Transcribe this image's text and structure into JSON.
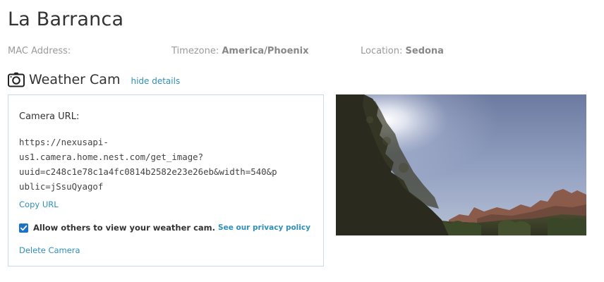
{
  "station": {
    "title": "La Barranca"
  },
  "meta": {
    "mac_label": "MAC Address:",
    "mac_value": "",
    "timezone_label": "Timezone:",
    "timezone_value": "America/Phoenix",
    "location_label": "Location:",
    "location_value": "Sedona"
  },
  "weather_cam": {
    "icon": "camera-icon",
    "title": "Weather Cam",
    "hide_details_label": "hide details",
    "camera_url_label": "Camera URL:",
    "camera_url_lines": [
      "https://nexusapi-",
      "us1.camera.home.nest.com/get_image?",
      "uuid=c248c1e78c1a4fc0814b2582e23e26eb&width=540&p",
      "ublic=jSsuQyagof"
    ],
    "copy_url_label": "Copy URL",
    "allow_checked": true,
    "allow_label": "Allow others to view your weather cam.",
    "privacy_link_label": "See our privacy policy",
    "delete_label": "Delete Camera"
  },
  "colors": {
    "link": "#2f8fb8",
    "checkbox": "#1a73c9",
    "card_border": "#c9dde0"
  }
}
